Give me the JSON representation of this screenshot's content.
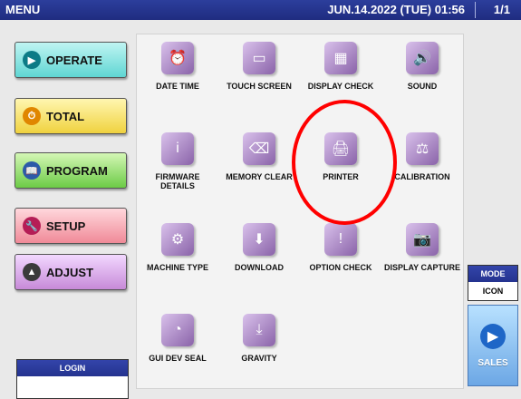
{
  "titlebar": {
    "left": "MENU",
    "datetime": "JUN.14.2022 (TUE) 01:56",
    "page": "1/1"
  },
  "sidebar": {
    "buttons": [
      {
        "label": "OPERATE",
        "icon": "play-icon"
      },
      {
        "label": "TOTAL",
        "icon": "clock-icon"
      },
      {
        "label": "PROGRAM",
        "icon": "book-icon"
      },
      {
        "label": "SETUP",
        "icon": "wrench-icon"
      },
      {
        "label": "ADJUST",
        "icon": "scale-icon"
      }
    ],
    "login_label": "LOGIN",
    "login_value": ""
  },
  "grid": {
    "items": [
      {
        "label": "DATE TIME",
        "icon": "calendar-clock-icon"
      },
      {
        "label": "TOUCH SCREEN",
        "icon": "touch-screen-icon"
      },
      {
        "label": "DISPLAY CHECK",
        "icon": "display-check-icon"
      },
      {
        "label": "SOUND",
        "icon": "speaker-icon"
      },
      {
        "label": "FIRMWARE DETAILS",
        "icon": "info-icon"
      },
      {
        "label": "MEMORY CLEAR",
        "icon": "memory-clear-icon"
      },
      {
        "label": "PRINTER",
        "icon": "printer-icon"
      },
      {
        "label": "CALIBRATION",
        "icon": "calibration-icon"
      },
      {
        "label": "MACHINE TYPE",
        "icon": "gears-icon"
      },
      {
        "label": "DOWNLOAD",
        "icon": "download-icon"
      },
      {
        "label": "OPTION CHECK",
        "icon": "option-check-icon"
      },
      {
        "label": "DISPLAY CAPTURE",
        "icon": "camera-icon"
      },
      {
        "label": "GUI DEV SEAL",
        "icon": "rainbow-icon"
      },
      {
        "label": "GRAVITY",
        "icon": "gravity-icon"
      }
    ]
  },
  "right": {
    "mode_label": "MODE",
    "mode_value": "ICON",
    "sales_label": "SALES",
    "sales_icon": "play-icon"
  },
  "colors": {
    "titlebar": "#25358f",
    "highlight_circle": "#ff0000",
    "tile_icon": "#8a63a9"
  }
}
